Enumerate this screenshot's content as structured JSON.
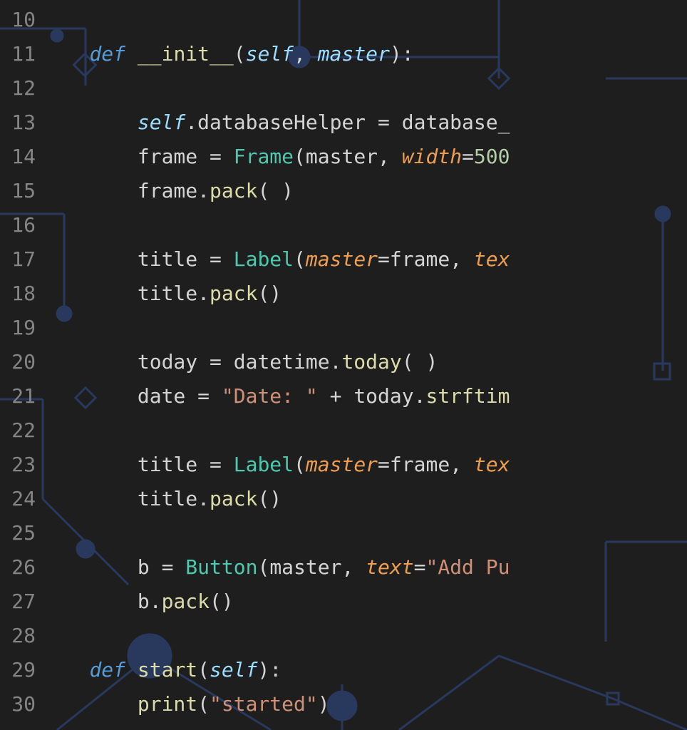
{
  "gutter": {
    "start": 10,
    "end": 30,
    "lines": [
      "10",
      "11",
      "12",
      "13",
      "14",
      "15",
      "16",
      "17",
      "18",
      "19",
      "20",
      "21",
      "22",
      "23",
      "24",
      "25",
      "26",
      "27",
      "28",
      "29",
      "30"
    ]
  },
  "code": {
    "lines": [
      {
        "n": 10,
        "tokens": [
          {
            "t": "",
            "c": "id"
          }
        ]
      },
      {
        "n": 11,
        "tokens": [
          {
            "t": "    ",
            "c": "id"
          },
          {
            "t": "def",
            "c": "kw"
          },
          {
            "t": " ",
            "c": "id"
          },
          {
            "t": "__init__",
            "c": "fn"
          },
          {
            "t": "(",
            "c": "op"
          },
          {
            "t": "self",
            "c": "self"
          },
          {
            "t": ", ",
            "c": "op"
          },
          {
            "t": "master",
            "c": "param"
          },
          {
            "t": ")",
            "c": "op"
          },
          {
            "t": ":",
            "c": "op"
          }
        ]
      },
      {
        "n": 12,
        "tokens": [
          {
            "t": "",
            "c": "id"
          }
        ]
      },
      {
        "n": 13,
        "tokens": [
          {
            "t": "        ",
            "c": "id"
          },
          {
            "t": "self",
            "c": "self"
          },
          {
            "t": ".",
            "c": "op"
          },
          {
            "t": "databaseHelper",
            "c": "id"
          },
          {
            "t": " = ",
            "c": "op"
          },
          {
            "t": "database_",
            "c": "id"
          }
        ]
      },
      {
        "n": 14,
        "tokens": [
          {
            "t": "        ",
            "c": "id"
          },
          {
            "t": "frame",
            "c": "id"
          },
          {
            "t": " = ",
            "c": "op"
          },
          {
            "t": "Frame",
            "c": "cls"
          },
          {
            "t": "(",
            "c": "op"
          },
          {
            "t": "master",
            "c": "id"
          },
          {
            "t": ", ",
            "c": "op"
          },
          {
            "t": "width",
            "c": "arg"
          },
          {
            "t": "=",
            "c": "op"
          },
          {
            "t": "500",
            "c": "num"
          }
        ]
      },
      {
        "n": 15,
        "tokens": [
          {
            "t": "        ",
            "c": "id"
          },
          {
            "t": "frame",
            "c": "id"
          },
          {
            "t": ".",
            "c": "op"
          },
          {
            "t": "pack",
            "c": "meth"
          },
          {
            "t": "( )",
            "c": "op"
          }
        ]
      },
      {
        "n": 16,
        "tokens": [
          {
            "t": "",
            "c": "id"
          }
        ]
      },
      {
        "n": 17,
        "tokens": [
          {
            "t": "        ",
            "c": "id"
          },
          {
            "t": "title",
            "c": "id"
          },
          {
            "t": " = ",
            "c": "op"
          },
          {
            "t": "Label",
            "c": "cls"
          },
          {
            "t": "(",
            "c": "op"
          },
          {
            "t": "master",
            "c": "arg"
          },
          {
            "t": "=",
            "c": "op"
          },
          {
            "t": "frame",
            "c": "id"
          },
          {
            "t": ", ",
            "c": "op"
          },
          {
            "t": "tex",
            "c": "arg"
          }
        ]
      },
      {
        "n": 18,
        "tokens": [
          {
            "t": "        ",
            "c": "id"
          },
          {
            "t": "title",
            "c": "id"
          },
          {
            "t": ".",
            "c": "op"
          },
          {
            "t": "pack",
            "c": "meth"
          },
          {
            "t": "()",
            "c": "op"
          }
        ]
      },
      {
        "n": 19,
        "tokens": [
          {
            "t": "",
            "c": "id"
          }
        ]
      },
      {
        "n": 20,
        "tokens": [
          {
            "t": "        ",
            "c": "id"
          },
          {
            "t": "today",
            "c": "id"
          },
          {
            "t": " = ",
            "c": "op"
          },
          {
            "t": "datetime",
            "c": "id"
          },
          {
            "t": ".",
            "c": "op"
          },
          {
            "t": "today",
            "c": "meth"
          },
          {
            "t": "( )",
            "c": "op"
          }
        ]
      },
      {
        "n": 21,
        "tokens": [
          {
            "t": "        ",
            "c": "id"
          },
          {
            "t": "date",
            "c": "id"
          },
          {
            "t": " = ",
            "c": "op"
          },
          {
            "t": "\"Date: \"",
            "c": "str"
          },
          {
            "t": " + ",
            "c": "op"
          },
          {
            "t": "today",
            "c": "id"
          },
          {
            "t": ".",
            "c": "op"
          },
          {
            "t": "strftim",
            "c": "meth"
          }
        ]
      },
      {
        "n": 22,
        "tokens": [
          {
            "t": "",
            "c": "id"
          }
        ]
      },
      {
        "n": 23,
        "tokens": [
          {
            "t": "        ",
            "c": "id"
          },
          {
            "t": "title",
            "c": "id"
          },
          {
            "t": " = ",
            "c": "op"
          },
          {
            "t": "Label",
            "c": "cls"
          },
          {
            "t": "(",
            "c": "op"
          },
          {
            "t": "master",
            "c": "arg"
          },
          {
            "t": "=",
            "c": "op"
          },
          {
            "t": "frame",
            "c": "id"
          },
          {
            "t": ", ",
            "c": "op"
          },
          {
            "t": "tex",
            "c": "arg"
          }
        ]
      },
      {
        "n": 24,
        "tokens": [
          {
            "t": "        ",
            "c": "id"
          },
          {
            "t": "title",
            "c": "id"
          },
          {
            "t": ".",
            "c": "op"
          },
          {
            "t": "pack",
            "c": "meth"
          },
          {
            "t": "()",
            "c": "op"
          }
        ]
      },
      {
        "n": 25,
        "tokens": [
          {
            "t": "",
            "c": "id"
          }
        ]
      },
      {
        "n": 26,
        "tokens": [
          {
            "t": "        ",
            "c": "id"
          },
          {
            "t": "b",
            "c": "id"
          },
          {
            "t": " = ",
            "c": "op"
          },
          {
            "t": "Button",
            "c": "cls"
          },
          {
            "t": "(",
            "c": "op"
          },
          {
            "t": "master",
            "c": "id"
          },
          {
            "t": ", ",
            "c": "op"
          },
          {
            "t": "text",
            "c": "arg"
          },
          {
            "t": "=",
            "c": "op"
          },
          {
            "t": "\"Add Pu",
            "c": "str"
          }
        ]
      },
      {
        "n": 27,
        "tokens": [
          {
            "t": "        ",
            "c": "id"
          },
          {
            "t": "b",
            "c": "id"
          },
          {
            "t": ".",
            "c": "op"
          },
          {
            "t": "pack",
            "c": "meth"
          },
          {
            "t": "()",
            "c": "op"
          }
        ]
      },
      {
        "n": 28,
        "tokens": [
          {
            "t": "",
            "c": "id"
          }
        ]
      },
      {
        "n": 29,
        "tokens": [
          {
            "t": "    ",
            "c": "id"
          },
          {
            "t": "def",
            "c": "kw"
          },
          {
            "t": " ",
            "c": "id"
          },
          {
            "t": "start",
            "c": "fn"
          },
          {
            "t": "(",
            "c": "op"
          },
          {
            "t": "self",
            "c": "self"
          },
          {
            "t": ")",
            "c": "op"
          },
          {
            "t": ":",
            "c": "op"
          }
        ]
      },
      {
        "n": 30,
        "tokens": [
          {
            "t": "        ",
            "c": "id"
          },
          {
            "t": "print",
            "c": "meth"
          },
          {
            "t": "(",
            "c": "op"
          },
          {
            "t": "\"started\"",
            "c": "str"
          },
          {
            "t": ")",
            "c": "op"
          }
        ]
      }
    ]
  }
}
